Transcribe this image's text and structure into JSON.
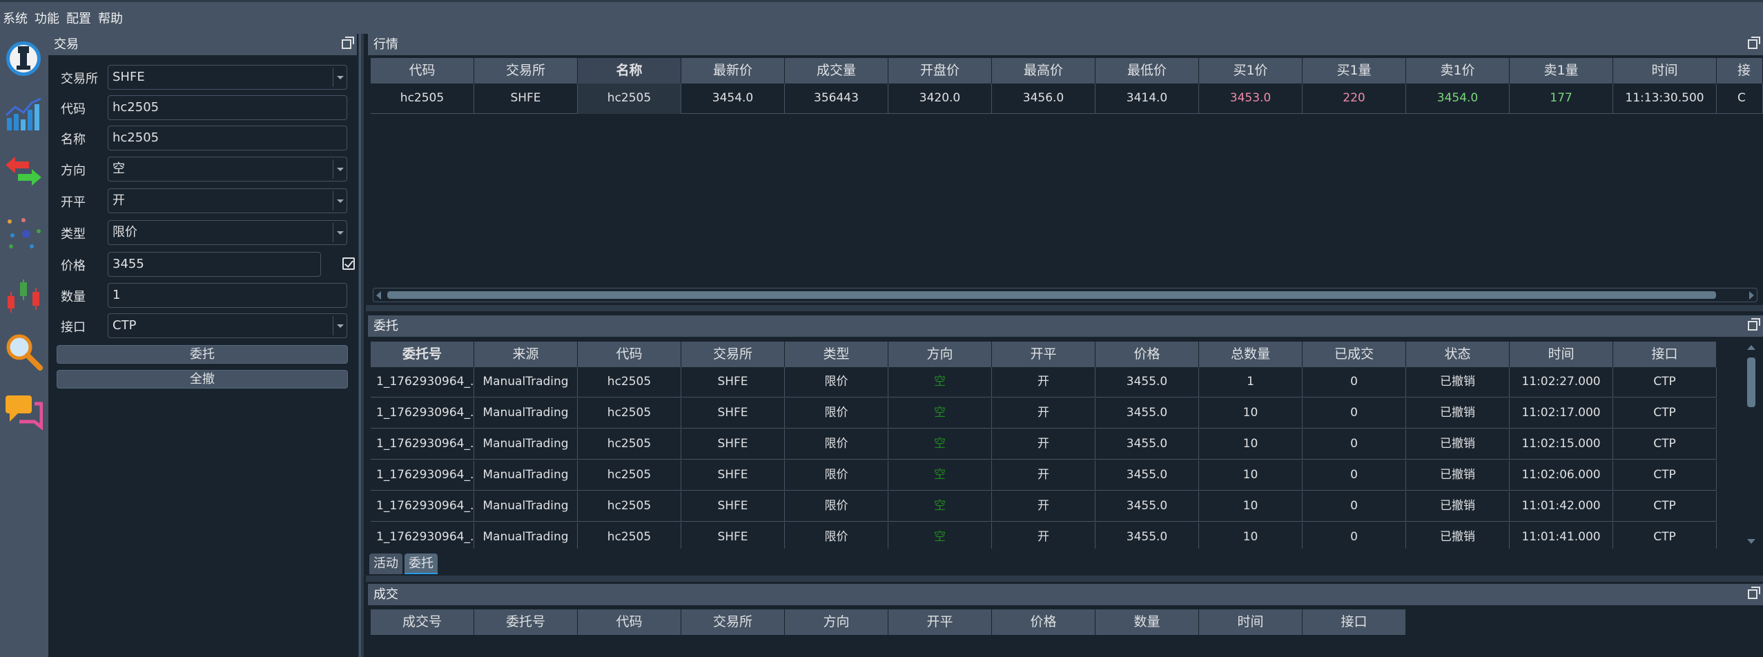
{
  "menu": [
    "系统",
    "功能",
    "配置",
    "帮助"
  ],
  "toolbar_icons": [
    "trading-icon",
    "chart-icon",
    "swap-arrows-icon",
    "scatter-dots-icon",
    "candlestick-icon",
    "search-icon",
    "chat-icon"
  ],
  "trade": {
    "title": "交易",
    "fields": [
      {
        "label": "交易所",
        "value": "SHFE",
        "kind": "combo"
      },
      {
        "label": "代码",
        "value": "hc2505",
        "kind": "input"
      },
      {
        "label": "名称",
        "value": "hc2505",
        "kind": "input"
      },
      {
        "label": "方向",
        "value": "空",
        "kind": "combo"
      },
      {
        "label": "开平",
        "value": "开",
        "kind": "combo"
      },
      {
        "label": "类型",
        "value": "限价",
        "kind": "combo"
      },
      {
        "label": "价格",
        "value": "3455",
        "kind": "input-check"
      },
      {
        "label": "数量",
        "value": "1",
        "kind": "input"
      },
      {
        "label": "接口",
        "value": "CTP",
        "kind": "combo"
      }
    ],
    "buttons": {
      "send": "委托",
      "cancel_all": "全撤"
    }
  },
  "market": {
    "title": "行情",
    "headers": [
      "代码",
      "交易所",
      "名称",
      "最新价",
      "成交量",
      "开盘价",
      "最高价",
      "最低价",
      "买1价",
      "买1量",
      "卖1价",
      "卖1量",
      "时间",
      "接"
    ],
    "rows": [
      [
        "hc2505",
        "SHFE",
        "hc2505",
        "3454.0",
        "356443",
        "3420.0",
        "3456.0",
        "3414.0",
        "3453.0",
        "220",
        "3454.0",
        "177",
        "11:13:30.500",
        "C"
      ]
    ]
  },
  "orders": {
    "title": "委托",
    "headers": [
      "委托号",
      "来源",
      "代码",
      "交易所",
      "类型",
      "方向",
      "开平",
      "价格",
      "总数量",
      "已成交",
      "状态",
      "时间",
      "接口"
    ],
    "rows": [
      [
        "1_1762930964_...",
        "ManualTrading",
        "hc2505",
        "SHFE",
        "限价",
        "空",
        "开",
        "3455.0",
        "1",
        "0",
        "已撤销",
        "11:02:27.000",
        "CTP"
      ],
      [
        "1_1762930964_...",
        "ManualTrading",
        "hc2505",
        "SHFE",
        "限价",
        "空",
        "开",
        "3455.0",
        "10",
        "0",
        "已撤销",
        "11:02:17.000",
        "CTP"
      ],
      [
        "1_1762930964_...",
        "ManualTrading",
        "hc2505",
        "SHFE",
        "限价",
        "空",
        "开",
        "3455.0",
        "10",
        "0",
        "已撤销",
        "11:02:15.000",
        "CTP"
      ],
      [
        "1_1762930964_...",
        "ManualTrading",
        "hc2505",
        "SHFE",
        "限价",
        "空",
        "开",
        "3455.0",
        "10",
        "0",
        "已撤销",
        "11:02:06.000",
        "CTP"
      ],
      [
        "1_1762930964_...",
        "ManualTrading",
        "hc2505",
        "SHFE",
        "限价",
        "空",
        "开",
        "3455.0",
        "10",
        "0",
        "已撤销",
        "11:01:42.000",
        "CTP"
      ],
      [
        "1_1762930964_...",
        "ManualTrading",
        "hc2505",
        "SHFE",
        "限价",
        "空",
        "开",
        "3455.0",
        "10",
        "0",
        "已撤销",
        "11:01:41.000",
        "CTP"
      ]
    ],
    "tabs": [
      "活动",
      "委托"
    ],
    "active_tab": 1
  },
  "trades": {
    "title": "成交",
    "headers": [
      "成交号",
      "委托号",
      "代码",
      "交易所",
      "方向",
      "开平",
      "价格",
      "数量",
      "时间",
      "接口"
    ]
  },
  "colors": {
    "bid": "#f08aa8",
    "ask": "#7cd67c",
    "short": "#1e8c1e",
    "panel": "#455364",
    "bg": "#19232d"
  }
}
